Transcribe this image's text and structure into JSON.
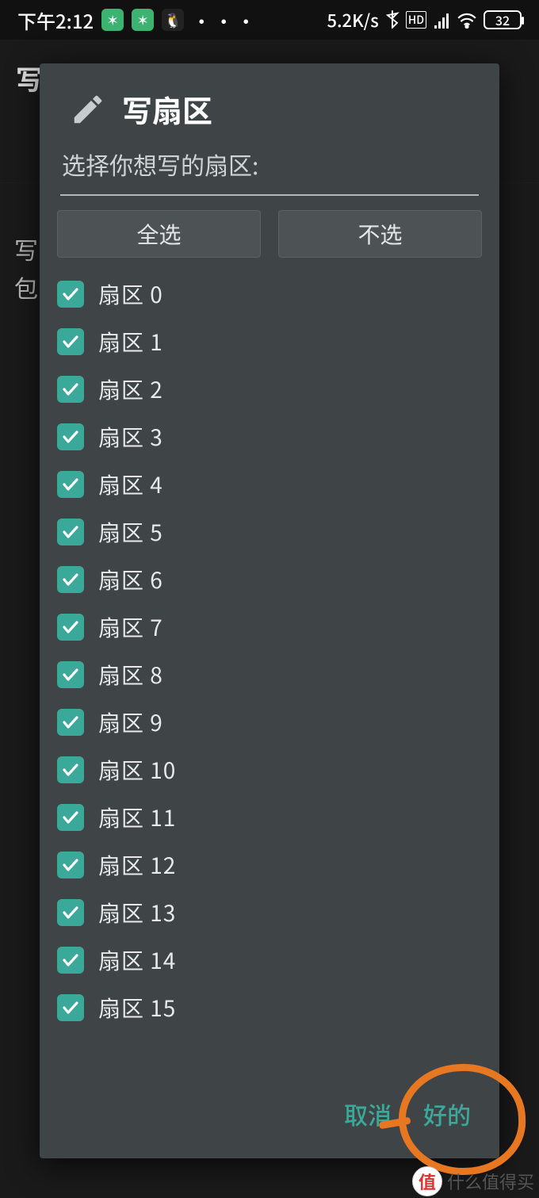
{
  "status": {
    "time": "下午2:12",
    "net_speed": "5.2K/s",
    "hd_label": "HD",
    "battery": "32",
    "icons": {
      "wechat": "wechat-icon",
      "wechat2": "wechat-icon",
      "qq": "qq-icon"
    }
  },
  "background": {
    "title_fragment": "写",
    "side_line1": "写",
    "side_line2": "包"
  },
  "dialog": {
    "title": "写扇区",
    "subtitle": "选择你想写的扇区:",
    "select_all": "全选",
    "select_none": "不选",
    "items": [
      {
        "label": "扇区 0",
        "checked": true
      },
      {
        "label": "扇区 1",
        "checked": true
      },
      {
        "label": "扇区 2",
        "checked": true
      },
      {
        "label": "扇区 3",
        "checked": true
      },
      {
        "label": "扇区 4",
        "checked": true
      },
      {
        "label": "扇区 5",
        "checked": true
      },
      {
        "label": "扇区 6",
        "checked": true
      },
      {
        "label": "扇区 7",
        "checked": true
      },
      {
        "label": "扇区 8",
        "checked": true
      },
      {
        "label": "扇区 9",
        "checked": true
      },
      {
        "label": "扇区 10",
        "checked": true
      },
      {
        "label": "扇区 11",
        "checked": true
      },
      {
        "label": "扇区 12",
        "checked": true
      },
      {
        "label": "扇区 13",
        "checked": true
      },
      {
        "label": "扇区 14",
        "checked": true
      },
      {
        "label": "扇区 15",
        "checked": true
      }
    ],
    "cancel": "取消",
    "ok": "好的"
  },
  "watermark": {
    "badge": "值",
    "text": "什么值得买"
  }
}
